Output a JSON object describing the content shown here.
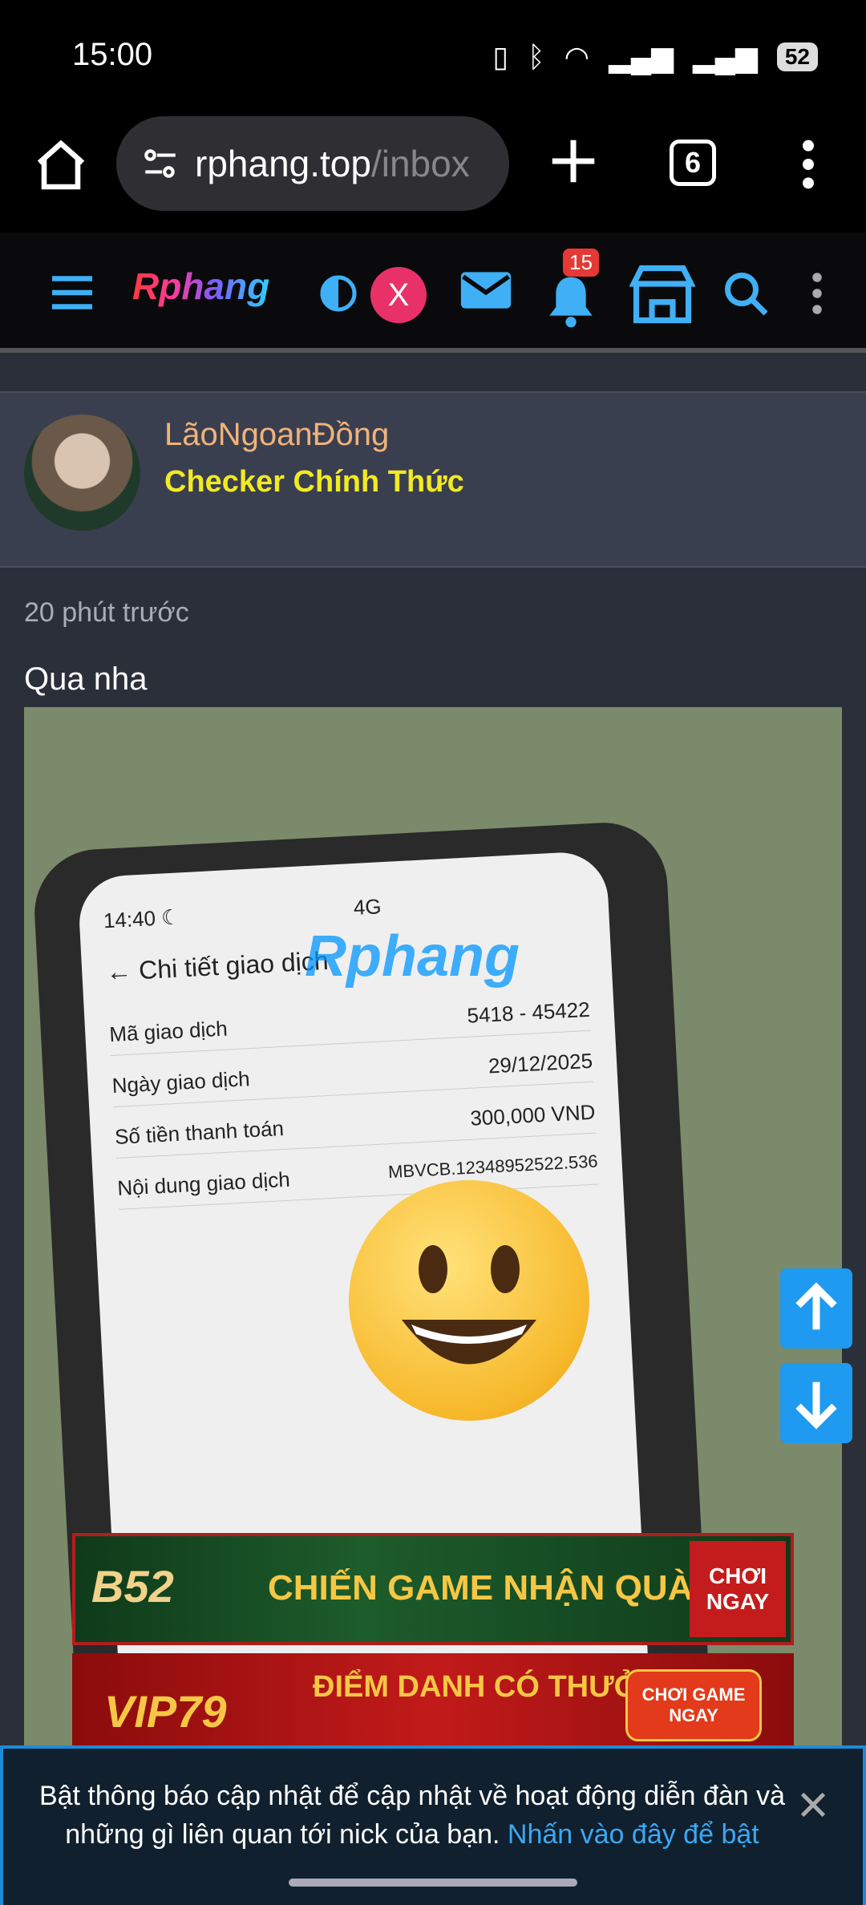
{
  "status_bar": {
    "time": "15:00",
    "battery": "52"
  },
  "browser": {
    "url_host": "rphang.top",
    "url_path": "/inbox",
    "tab_count": "6"
  },
  "site": {
    "logo": "Rphang",
    "x_badge": "X",
    "notification_count": "15"
  },
  "post": {
    "author": "LãoNgoanĐồng",
    "author_title": "Checker Chính Thức",
    "time": "20 phút trước",
    "text": "Qua nha"
  },
  "photo": {
    "phone_time": "14:40",
    "phone_net": "4G",
    "screen_title": "Chi tiết giao dịch",
    "watermark": "Rphang",
    "rows": [
      {
        "label": "Mã giao dịch",
        "value": "5418 - 45422"
      },
      {
        "label": "Ngày giao dịch",
        "value": "29/12/2025"
      },
      {
        "label": "Số tiền thanh toán",
        "value": "300,000 VND"
      },
      {
        "label": "Nội dung giao dịch",
        "value": "MBVCB.12348952522.536"
      }
    ],
    "banner1_brand": "B52",
    "banner1_text": "CHIẾN GAME NHẬN QUÀ",
    "banner1_cta": "CHƠI NGAY",
    "banner2_brand": "VIP79",
    "banner2_text": "ĐIỂM DANH CÓ THƯỞNG",
    "banner2_cta": "CHƠI GAME NGAY"
  },
  "notice": {
    "message": "Bật thông báo cập nhật để cập nhật về hoạt động diễn đàn và những gì liên quan tới nick của bạn.",
    "link": "Nhấn vào đây để bật"
  },
  "colors": {
    "accent": "#1e9af0",
    "username": "#f1b27a",
    "title": "#f2ea22",
    "badge": "#e83168"
  }
}
